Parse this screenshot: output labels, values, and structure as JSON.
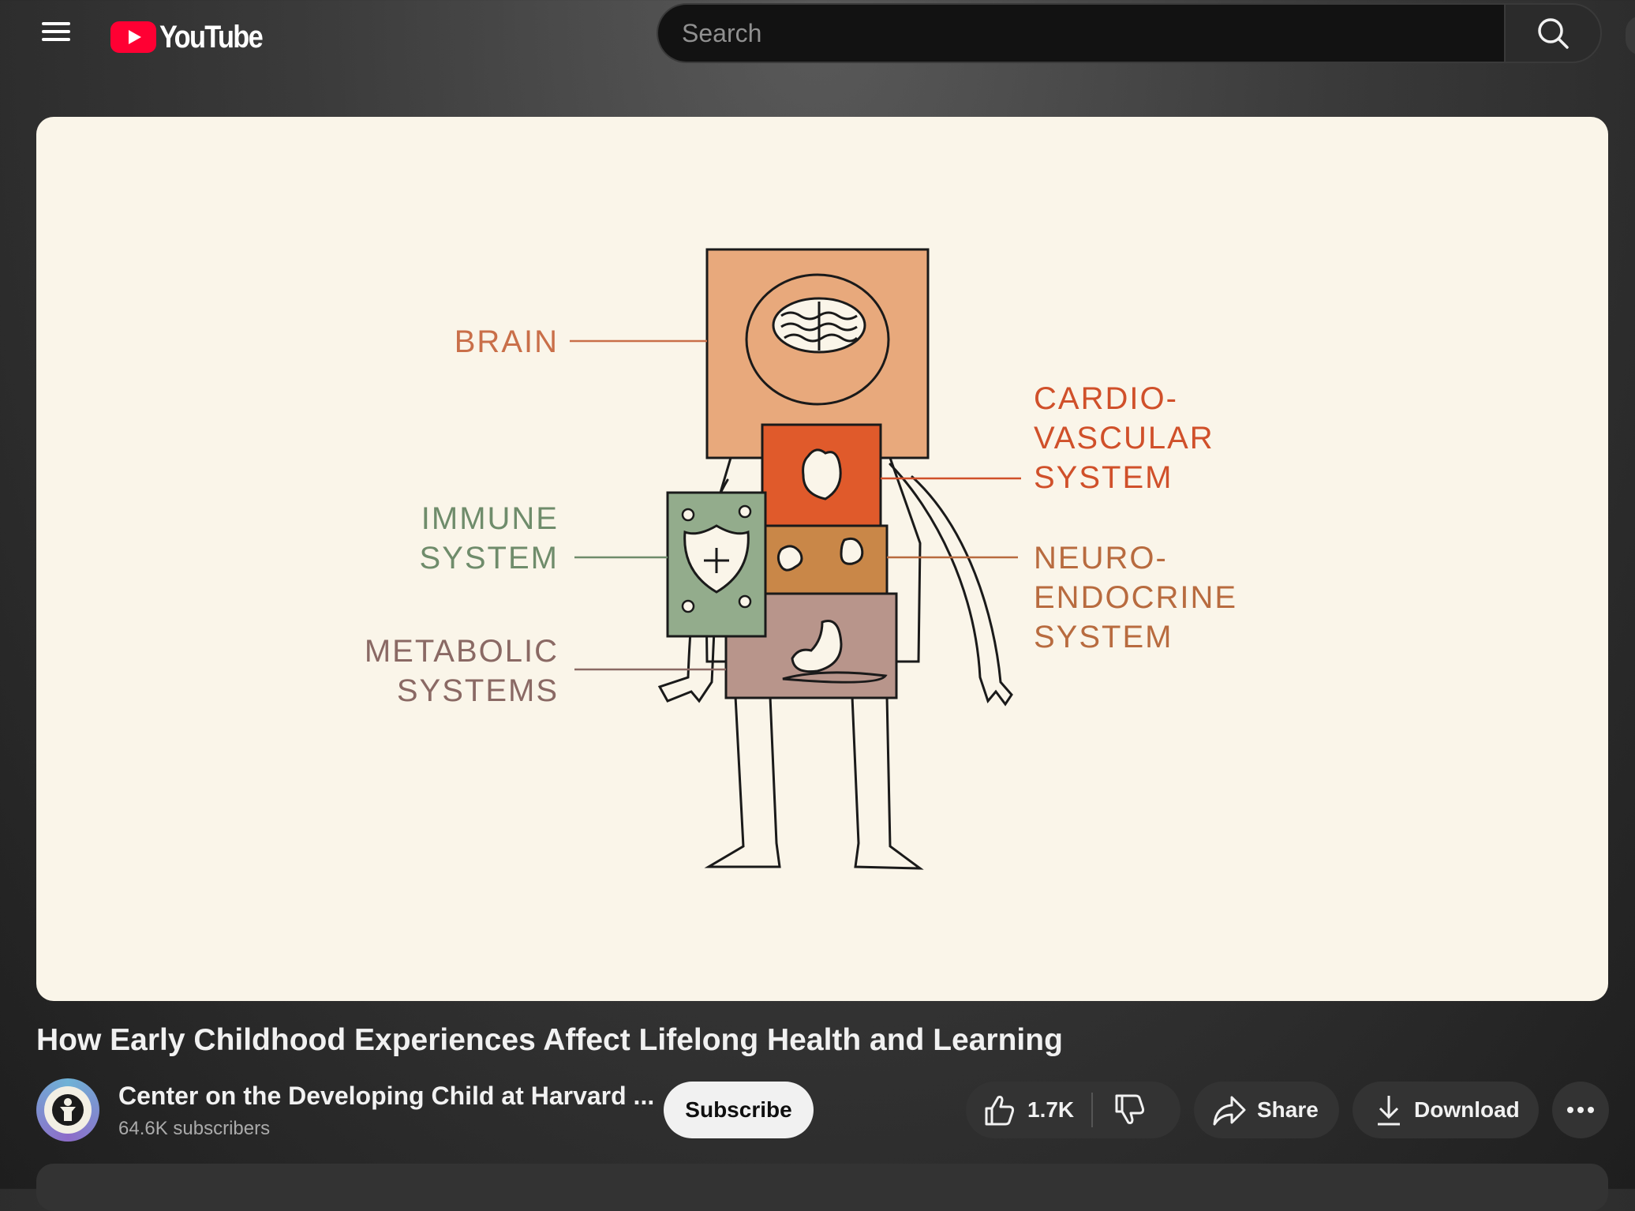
{
  "app": {
    "logo_text": "YouTube",
    "brand_color": "#ff0033"
  },
  "search": {
    "placeholder": "Search"
  },
  "video": {
    "title": "How Early Childhood Experiences Affect Lifelong Health and Learning",
    "frame_labels": {
      "brain": "BRAIN",
      "cardio": [
        "CARDIO-",
        "VASCULAR",
        "SYSTEM"
      ],
      "immune": [
        "IMMUNE",
        "SYSTEM"
      ],
      "neuro": [
        "NEURO-",
        "ENDOCRINE",
        "SYSTEM"
      ],
      "metabolic": [
        "METABOLIC",
        "SYSTEMS"
      ]
    },
    "frame_colors": {
      "background": "#faf5e9",
      "brain_box": "#e8a97c",
      "heart_box": "#e05a2b",
      "kidney_box": "#c98748",
      "stomach_box": "#b8958b",
      "immune_box": "#93ac8c",
      "brain_label": "#c96f49",
      "cardio_label": "#d0502a",
      "immune_label": "#6f8c6b",
      "neuro_label": "#b86b3f",
      "metabolic_label": "#8a6964"
    }
  },
  "channel": {
    "name": "Center on the Developing Child at Harvard ...",
    "subscribers": "64.6K subscribers",
    "subscribe_label": "Subscribe"
  },
  "actions": {
    "like_count": "1.7K",
    "share_label": "Share",
    "download_label": "Download"
  },
  "icons": [
    "menu-icon",
    "youtube-logo-icon",
    "search-icon",
    "like-icon",
    "dislike-icon",
    "share-icon",
    "download-icon",
    "more-icon"
  ]
}
